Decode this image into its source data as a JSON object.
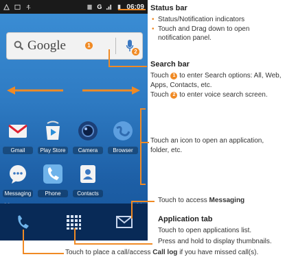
{
  "status_bar": {
    "time": "06:09",
    "signal": "G"
  },
  "search": {
    "brand": "Google",
    "badge1": "1",
    "badge2": "2"
  },
  "apps": [
    {
      "label": "Gmail",
      "icon": "gmail-icon"
    },
    {
      "label": "Play Store",
      "icon": "play-store-icon"
    },
    {
      "label": "Camera",
      "icon": "camera-icon"
    },
    {
      "label": "Browser",
      "icon": "browser-icon"
    },
    {
      "label": "Messaging",
      "icon": "messaging-icon"
    },
    {
      "label": "Phone",
      "icon": "phone-icon"
    },
    {
      "label": "Contacts",
      "icon": "contacts-icon"
    }
  ],
  "annotations": {
    "status_bar_title": "Status bar",
    "status_bar_b1": "Status/Notification indicators",
    "status_bar_b2": "Touch and Drag down to open notification panel.",
    "search_bar_title": "Search bar",
    "search_text1_pre": "Touch",
    "search_text1_post": "to enter Search options: All, Web, Apps, Contacts, etc.",
    "search_text2_pre": "Touch",
    "search_text2_post": "to enter voice search screen.",
    "icons_text": "Touch an icon to open an application, folder, etc.",
    "messaging_pre": "Touch to access ",
    "messaging_bold": "Messaging",
    "app_tab_title": "Application tab",
    "app_tab_l1": "Touch to open applications list.",
    "app_tab_l2": "Press and hold to display thumbnails.",
    "calllog_pre": "Touch to place a call/access ",
    "calllog_bold": "Call log",
    "calllog_post": " if you have missed call(s)."
  },
  "colors": {
    "accent": "#f08a24",
    "screen": "#2f7cc4",
    "dock": "#082a57"
  }
}
